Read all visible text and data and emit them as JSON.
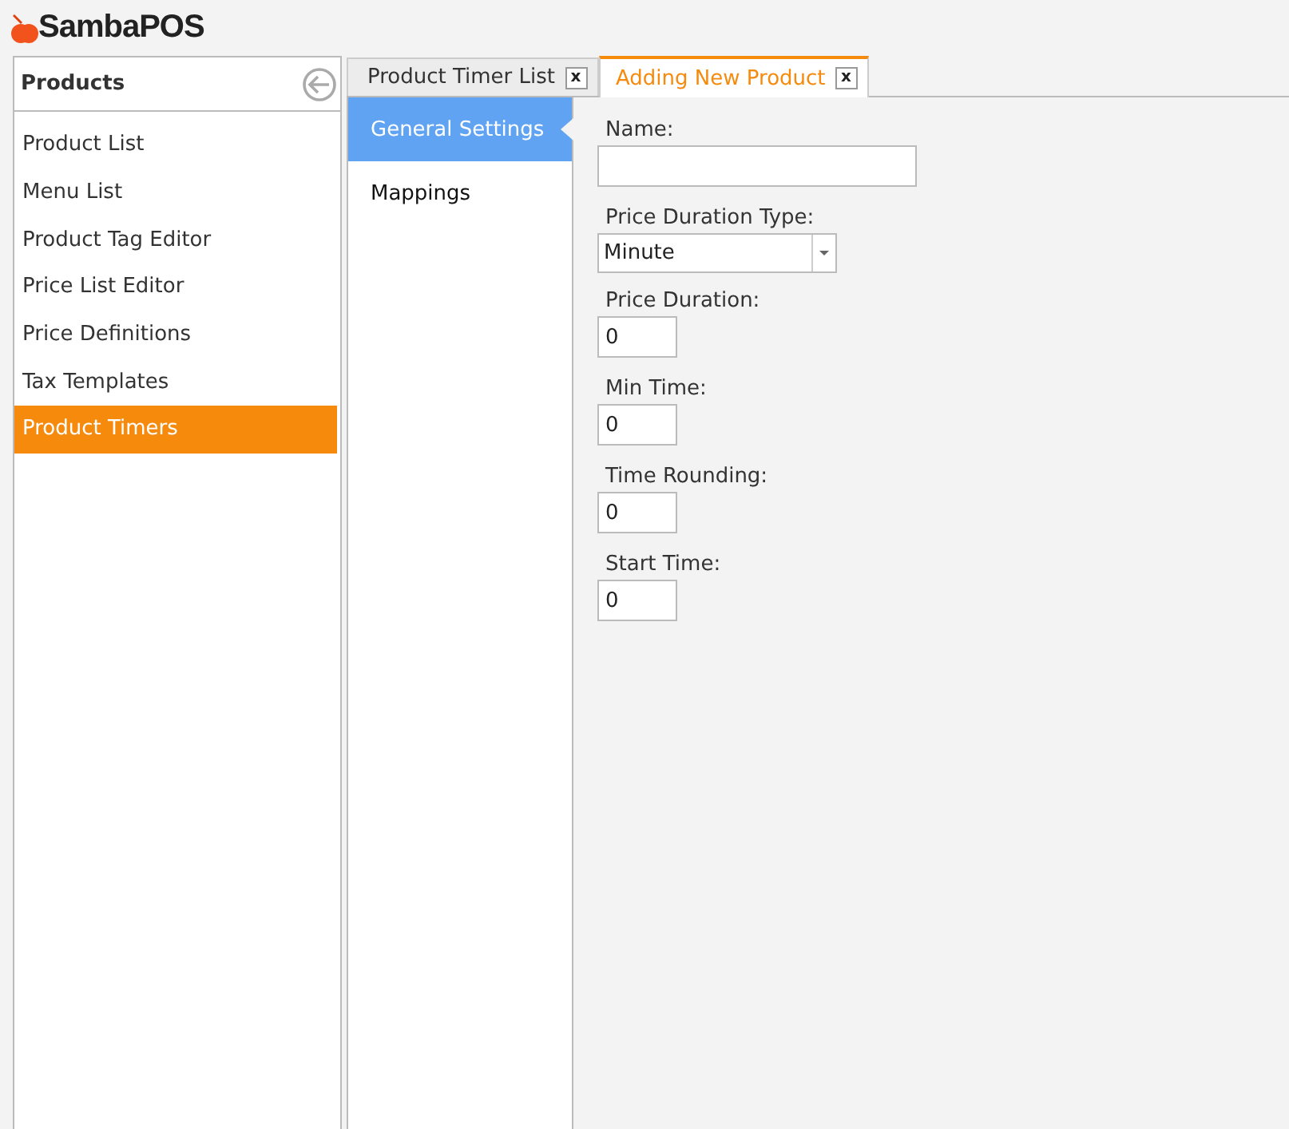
{
  "app": {
    "logo": "SambaPOS"
  },
  "sidebar": {
    "title": "Products",
    "items": [
      {
        "label": "Product List",
        "selected": false
      },
      {
        "label": "Menu List",
        "selected": false
      },
      {
        "label": "Product Tag Editor",
        "selected": false
      },
      {
        "label": "Price List Editor",
        "selected": false
      },
      {
        "label": "Price Definitions",
        "selected": false
      },
      {
        "label": "Tax Templates",
        "selected": false
      },
      {
        "label": "Product Timers",
        "selected": true
      }
    ]
  },
  "tabs": [
    {
      "label": "Product Timer List",
      "close": "x",
      "selected": false
    },
    {
      "label": "Adding New Product",
      "close": "x",
      "selected": true
    }
  ],
  "sections": [
    {
      "label": "General Settings",
      "selected": true
    },
    {
      "label": "Mappings",
      "selected": false
    }
  ],
  "fields": [
    {
      "kind": "text",
      "label": "Name:"
    },
    {
      "kind": "dropdown",
      "label": "Price Duration Type:",
      "value": "Minute"
    },
    {
      "kind": "number",
      "label": "Price Duration:",
      "value": "0"
    },
    {
      "kind": "number",
      "label": "Min Time:",
      "value": "0"
    },
    {
      "kind": "number",
      "label": "Time Rounding:",
      "value": "0"
    },
    {
      "kind": "number",
      "label": "Start Time:",
      "value": "0"
    }
  ]
}
